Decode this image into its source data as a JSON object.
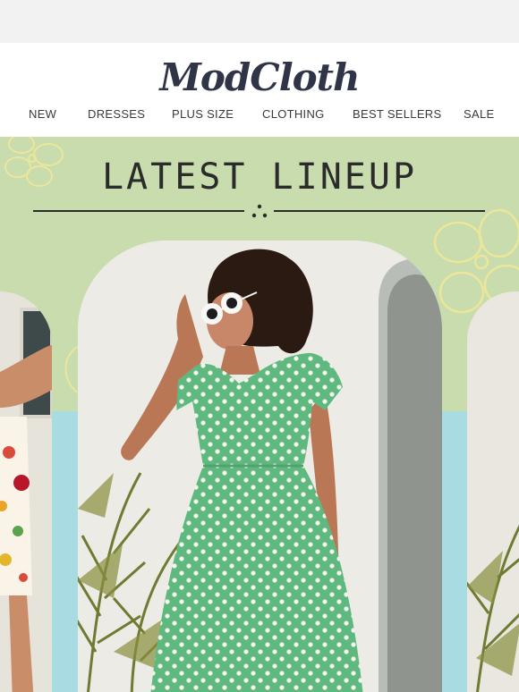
{
  "brand": {
    "logo_text": "ModCloth"
  },
  "nav": {
    "items": [
      {
        "label": "NEW"
      },
      {
        "label": "DRESSES"
      },
      {
        "label": "PLUS SIZE"
      },
      {
        "label": "CLOTHING"
      },
      {
        "label": "BEST SELLERS"
      },
      {
        "label": "SALE"
      }
    ]
  },
  "hero": {
    "title": "LATEST LINEUP"
  },
  "colors": {
    "header_bg": "#ffffff",
    "logo": "#2f3447",
    "hero_green": "#c8dcae",
    "hero_aqua": "#a8dce2",
    "dress_green": "#5fb97f",
    "flower_outline": "#e9e28a"
  },
  "icons": [
    "flower-outline-icon",
    "three-dots-ornament-icon"
  ]
}
